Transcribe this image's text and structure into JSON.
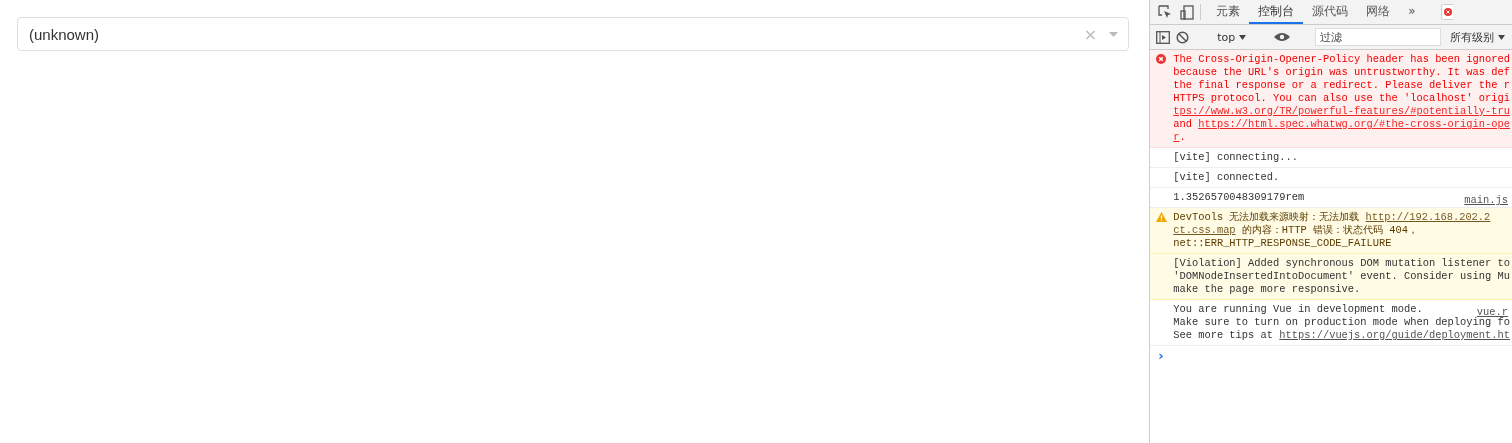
{
  "select": {
    "value": "(unknown)",
    "clear": "×"
  },
  "devtools": {
    "tabs": [
      {
        "label": "元素",
        "selected": false
      },
      {
        "label": "控制台",
        "selected": true
      },
      {
        "label": "源代码",
        "selected": false
      },
      {
        "label": "网络",
        "selected": false
      }
    ],
    "more": "»",
    "toolbar": {
      "context": "top",
      "filter_placeholder": "过滤",
      "levels": "所有级别"
    },
    "messages": [
      {
        "kind": "error",
        "lines": [
          [
            {
              "text": "The Cross-Origin-Opener-Policy header has been ignored",
              "link": false
            }
          ],
          [
            {
              "text": "because the URL's origin was untrustworthy. It was def",
              "link": false
            }
          ],
          [
            {
              "text": "the final response or a redirect. Please deliver the r",
              "link": false
            }
          ],
          [
            {
              "text": "HTTPS protocol. You can also use the 'localhost' origi",
              "link": false
            }
          ],
          [
            {
              "text": "tps://www.w3.org/TR/powerful-features/#potentially-tru",
              "link": true
            }
          ],
          [
            {
              "text": "and ",
              "link": false
            },
            {
              "text": "https://html.spec.whatwg.org/#the-cross-origin-ope",
              "link": true
            }
          ],
          [
            {
              "text": "r",
              "link": true
            },
            {
              "text": ".",
              "link": false
            }
          ]
        ]
      },
      {
        "kind": "info",
        "lines": [
          [
            {
              "text": "[vite] connecting...",
              "link": false
            }
          ]
        ]
      },
      {
        "kind": "info",
        "lines": [
          [
            {
              "text": "[vite] connected.",
              "link": false
            }
          ]
        ]
      },
      {
        "kind": "info",
        "source": "main.js",
        "lines": [
          [
            {
              "text": "1.3526570048309179rem",
              "link": false
            }
          ]
        ]
      },
      {
        "kind": "warning",
        "lines": [
          [
            {
              "text": "DevTools 无法加载来源映射：无法加载 ",
              "link": false
            },
            {
              "text": "http://192.168.202.2",
              "link": true
            }
          ],
          [
            {
              "text": "ct.css.map",
              "link": true
            },
            {
              "text": " 的内容：HTTP 错误：状态代码 404，",
              "link": false
            }
          ],
          [
            {
              "text": "net::ERR_HTTP_RESPONSE_CODE_FAILURE",
              "link": false
            }
          ]
        ]
      },
      {
        "kind": "violation",
        "lines": [
          [
            {
              "text": "[Violation] Added synchronous DOM mutation listener to",
              "link": false
            }
          ],
          [
            {
              "text": "'DOMNodeInsertedIntoDocument' event. Consider using Mu",
              "link": false
            }
          ],
          [
            {
              "text": "make the page more responsive.",
              "link": false
            }
          ]
        ]
      },
      {
        "kind": "info",
        "source": "vue.r",
        "lines": [
          [
            {
              "text": "You are running Vue in development mode.",
              "link": false
            }
          ],
          [
            {
              "text": "Make sure to turn on production mode when deploying fo",
              "link": false
            }
          ],
          [
            {
              "text": "See more tips at ",
              "link": false
            },
            {
              "text": "https://vuejs.org/guide/deployment.ht",
              "link": true
            }
          ]
        ]
      }
    ],
    "prompt": "›"
  }
}
